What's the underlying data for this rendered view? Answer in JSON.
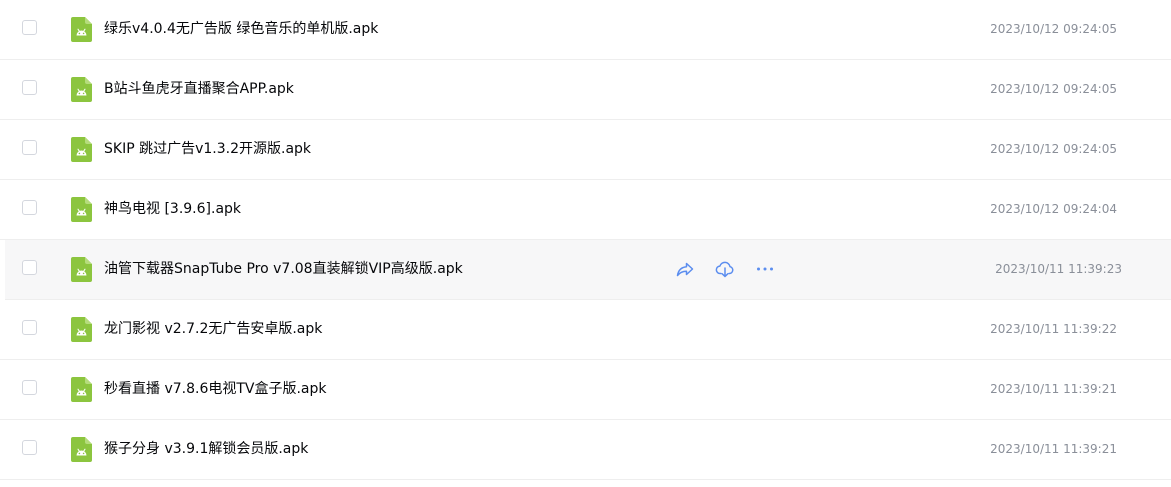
{
  "colors": {
    "apk_icon": "#8cc53f",
    "action_icon": "#5b8def",
    "hover_row": "#f7f7f8"
  },
  "files": [
    {
      "name": "绿乐v4.0.4无广告版 绿色音乐的单机版.apk",
      "date": "2023/10/12 09:24:05",
      "icon": "android-apk-icon"
    },
    {
      "name": "B站斗鱼虎牙直播聚合APP.apk",
      "date": "2023/10/12 09:24:05",
      "icon": "android-apk-icon"
    },
    {
      "name": "SKIP 跳过广告v1.3.2开源版.apk",
      "date": "2023/10/12 09:24:05",
      "icon": "android-apk-icon"
    },
    {
      "name": "神鸟电视 [3.9.6].apk",
      "date": "2023/10/12 09:24:04",
      "icon": "android-apk-icon"
    },
    {
      "name": "油管下载器SnapTube Pro v7.08直装解锁VIP高级版.apk",
      "date": "2023/10/11 11:39:23",
      "icon": "android-apk-icon",
      "hovered": true
    },
    {
      "name": "龙门影视 v2.7.2无广告安卓版.apk",
      "date": "2023/10/11 11:39:22",
      "icon": "android-apk-icon"
    },
    {
      "name": "秒看直播 v7.8.6电视TV盒子版.apk",
      "date": "2023/10/11 11:39:21",
      "icon": "android-apk-icon"
    },
    {
      "name": "猴子分身 v3.9.1解锁会员版.apk",
      "date": "2023/10/11 11:39:21",
      "icon": "android-apk-icon"
    }
  ],
  "hover_actions": [
    "share-icon",
    "download-icon",
    "more-icon"
  ]
}
